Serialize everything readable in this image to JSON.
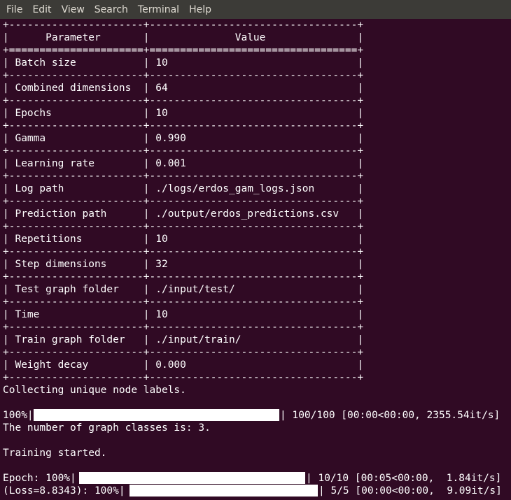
{
  "menu": [
    "File",
    "Edit",
    "View",
    "Search",
    "Terminal",
    "Help"
  ],
  "table": {
    "border": "+----------------------+----------------------------------+",
    "header_border": "+======================+==================================+",
    "header": "|      Parameter       |              Value               |",
    "rows": [
      "| Batch size           | 10                               |",
      "| Combined dimensions  | 64                               |",
      "| Epochs               | 10                               |",
      "| Gamma                | 0.990                            |",
      "| Learning rate        | 0.001                            |",
      "| Log path             | ./logs/erdos_gam_logs.json       |",
      "| Prediction path      | ./output/erdos_predictions.csv   |",
      "| Repetitions          | 10                               |",
      "| Step dimensions      | 32                               |",
      "| Test graph folder    | ./input/test/                    |",
      "| Time                 | 10                               |",
      "| Train graph folder   | ./input/train/                   |",
      "| Weight decay         | 0.000                            |"
    ]
  },
  "output": {
    "collecting": "Collecting unique node labels.",
    "progress1": {
      "prefix": "100%|",
      "suffix": "| 100/100 [00:00<00:00, 2355.54it/s]",
      "fill_fraction": 1.0
    },
    "classes": "The number of graph classes is: 3.",
    "training": "Training started.",
    "progress2": {
      "prefix": "Epoch: 100%|",
      "suffix": "| 10/10 [00:05<00:00,  1.84it/s]",
      "fill_fraction": 1.0
    },
    "progress3": {
      "prefix": "(Loss=8.8343): 100%|",
      "suffix": "| 5/5 [00:00<00:00,  9.09it/s]",
      "fill_fraction": 1.0
    }
  },
  "colors": {
    "background": "#300a24",
    "menubar": "#3c3b37",
    "text": "#ffffff"
  }
}
